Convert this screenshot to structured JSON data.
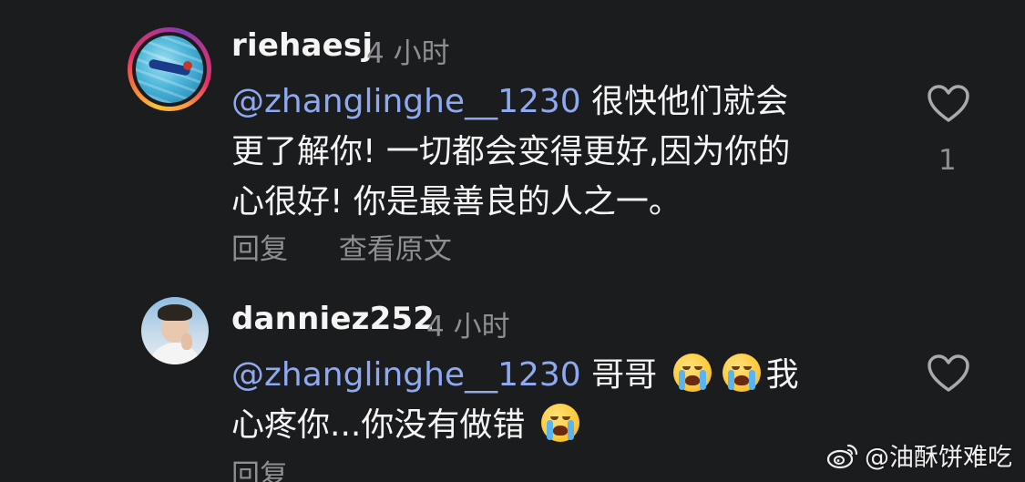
{
  "comments": [
    {
      "username": "riehaesj",
      "time": "4 小时",
      "mention": "@zhanglinghe__1230",
      "text_lines": [
        "很快他们就会",
        "更了解你! 一切都会变得更好,因为你的",
        "心很好! 你是最善良的人之一。"
      ],
      "reply_label": "回复",
      "translate_label": "查看原文",
      "like_count": "1",
      "avatar_icon": "swimmer-pool-avatar",
      "has_story_ring": true
    },
    {
      "username": "danniez252",
      "time": "4 小时",
      "mention": "@zhanglinghe__1230",
      "text_part1": "哥哥",
      "text_part2": "我",
      "text_line2": "心疼你...你没有做错",
      "emoji_name": "loudly-crying-face",
      "reply_label": "回复",
      "avatar_icon": "person-portrait-avatar"
    }
  ],
  "icons": {
    "like": "heart-outline-icon",
    "watermark_logo": "weibo-logo-icon"
  },
  "watermark": {
    "text": "@油酥饼难吃"
  },
  "colors": {
    "background": "#1b1c1e",
    "mention": "#8ea9f0",
    "secondary_text": "#8e8e93",
    "primary_text": "#f5f5f5"
  }
}
